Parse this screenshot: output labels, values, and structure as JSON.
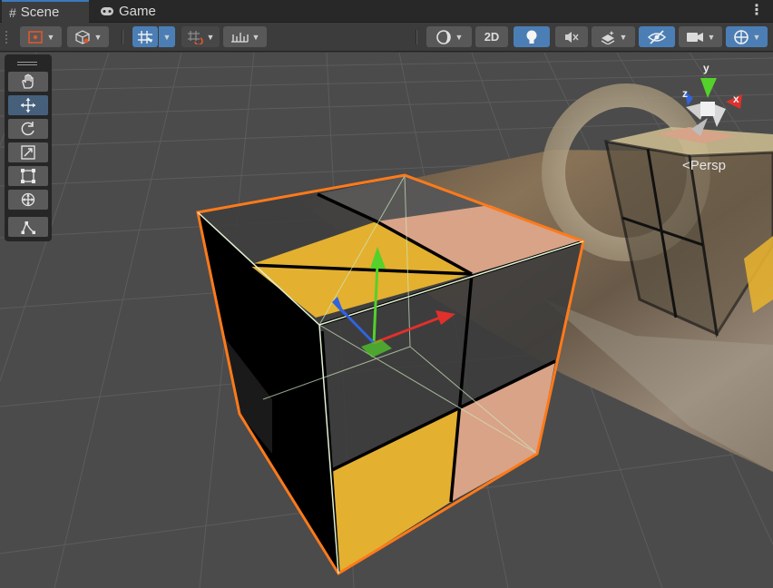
{
  "tabs": [
    {
      "label": "Scene",
      "icon": "hash-icon",
      "active": true
    },
    {
      "label": "Game",
      "icon": "gamepad-icon",
      "active": false
    }
  ],
  "toolbar": {
    "mode_2d_label": "2D"
  },
  "gizmo": {
    "x_label": "x",
    "y_label": "y",
    "z_label": "z",
    "projection_label": "Persp"
  },
  "colors": {
    "selection_outline": "#ff7a1a",
    "yellow_face": "#e3b030",
    "peach_face": "#d9a387",
    "axis_x": "#e0302c",
    "axis_y": "#54d12a",
    "axis_z": "#2f63e0",
    "toolbar_accent": "#46607c"
  }
}
